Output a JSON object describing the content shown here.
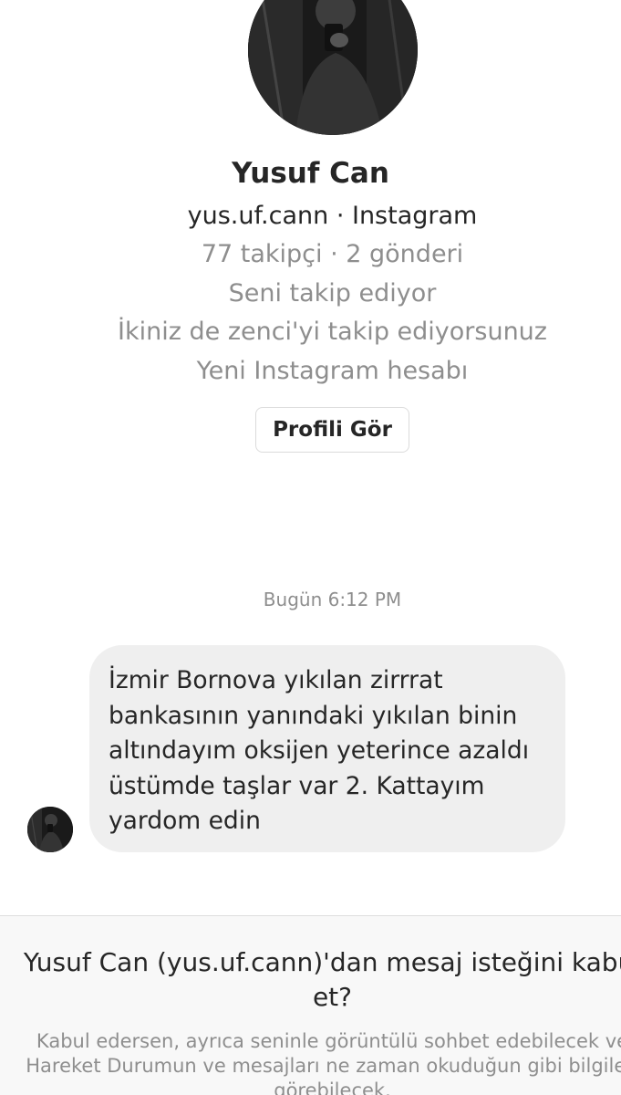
{
  "profile": {
    "name": "Yusuf Can",
    "handle_line": "yus.uf.cann · Instagram",
    "stats": "77 takipçi · 2 gönderi",
    "follows_you": "Seni takip ediyor",
    "mutual": "İkiniz de zenci'yi takip ediyorsunuz",
    "new_account": "Yeni Instagram hesabı",
    "view_profile_label": "Profili Gör"
  },
  "conversation": {
    "timestamp": "Bugün 6:12 PM",
    "message": "İzmir Bornova yıkılan zirrrat\nbankasının yanındaki yıkılan binin\naltındayım oksijen yeterince azaldı\nüstümde taşlar var 2. Kattayım\nyardom edin"
  },
  "request": {
    "title_line1": "Yusuf Can (yus.uf.cann)'dan mesaj isteğini kabul",
    "title_line2": "et?",
    "desc_line1": "Kabul edersen, ayrıca seninle görüntülü sohbet edebilecek ve",
    "desc_line2": "Hareket Durumun ve mesajları ne zaman okuduğun gibi bilgileri",
    "desc_line3": "görebilecek."
  },
  "colors": {
    "text_primary": "#262626",
    "text_secondary": "#8e8e8e",
    "bubble": "#efefef",
    "panel": "#f8f8f8",
    "border": "#dbdbdb"
  },
  "icons": {
    "profile_photo": "avatar-photo",
    "sender_photo": "avatar-photo"
  }
}
